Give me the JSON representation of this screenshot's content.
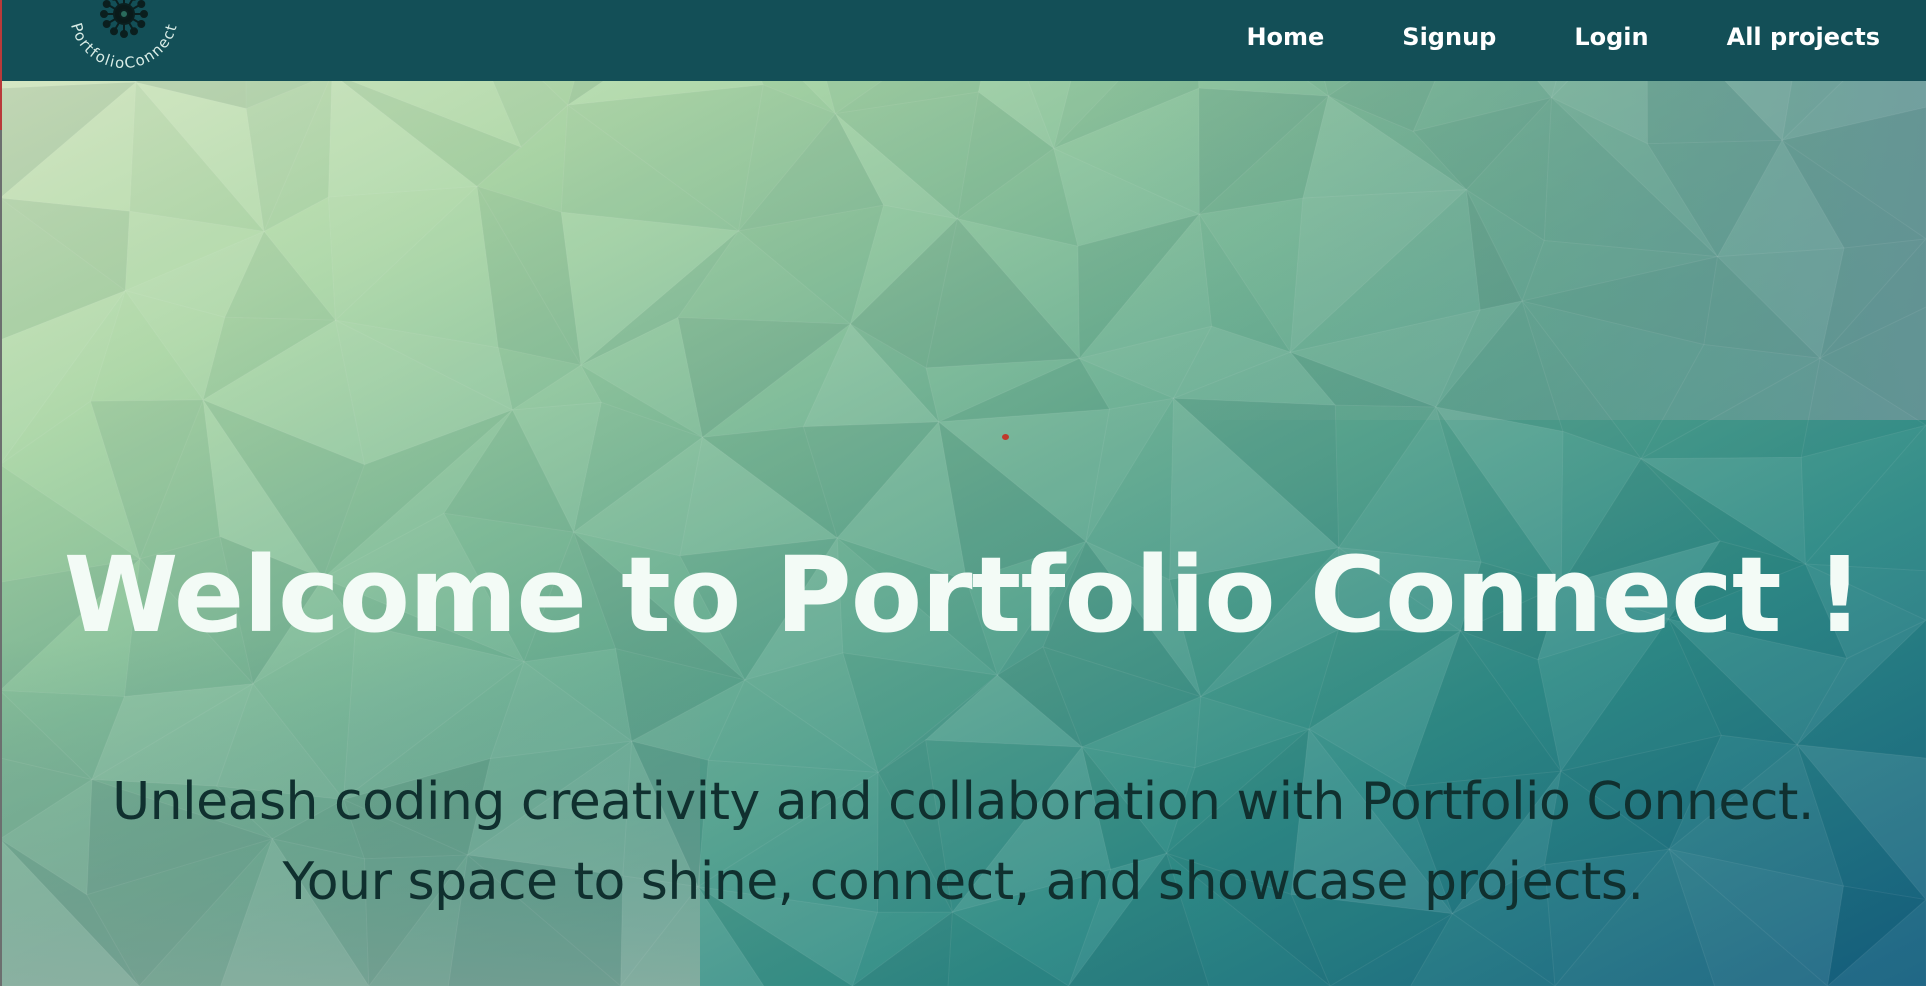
{
  "colors": {
    "navbar_bg": "#134f57",
    "title_color": "#f3fbf6",
    "subtitle_color": "#10302f",
    "bg_light": "#d4e8c2",
    "bg_dark": "#165f7e"
  },
  "logo": {
    "text": "PortfolioConnect",
    "icon": "network-node-icon"
  },
  "nav": {
    "items": [
      {
        "label": "Home"
      },
      {
        "label": "Signup"
      },
      {
        "label": "Login"
      },
      {
        "label": "All projects"
      }
    ]
  },
  "hero": {
    "title": "Welcome to Portfolio Connect !",
    "subtitle": "Unleash coding creativity and collaboration with Portfolio Connect. Your space to shine, connect, and showcase projects."
  }
}
